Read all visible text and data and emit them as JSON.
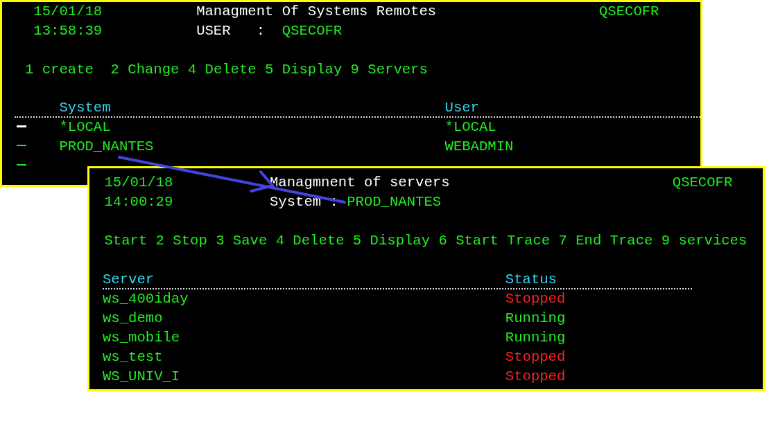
{
  "systems_screen": {
    "date": "15/01/18",
    "time": "13:58:39",
    "title": "Managment Of Systems Remotes",
    "user_label": "USER   :",
    "user": "QSECOFR",
    "profile": "QSECOFR",
    "options": "1 create  2 Change 4 Delete 5 Display 9 Servers",
    "columns": [
      "System",
      "User"
    ],
    "rows": [
      {
        "cursor": true,
        "system": "*LOCAL",
        "user": "*LOCAL"
      },
      {
        "cursor": false,
        "system": "PROD_NANTES",
        "user": "WEBADMIN"
      },
      {
        "cursor": false
      }
    ]
  },
  "servers_screen": {
    "date": "15/01/18",
    "time": "14:00:29",
    "title": "Managmnent of servers",
    "system_label": "System :",
    "system": "PROD_NANTES",
    "profile": "QSECOFR",
    "options": "Start 2 Stop 3 Save 4 Delete 5 Display 6 Start Trace 7 End Trace 9 services",
    "columns": [
      "Server",
      "Status"
    ],
    "rows": [
      {
        "server": "ws_400iday",
        "status": "Stopped",
        "color": "#ff2020"
      },
      {
        "server": "ws_demo",
        "status": "Running",
        "color": "#22ee22"
      },
      {
        "server": "ws_mobile",
        "status": "Running",
        "color": "#22ee22"
      },
      {
        "server": "ws_test",
        "status": "Stopped",
        "color": "#ff2020"
      },
      {
        "server": "WS_UNIV_I",
        "status": "Stopped",
        "color": "#ff2020"
      }
    ]
  }
}
